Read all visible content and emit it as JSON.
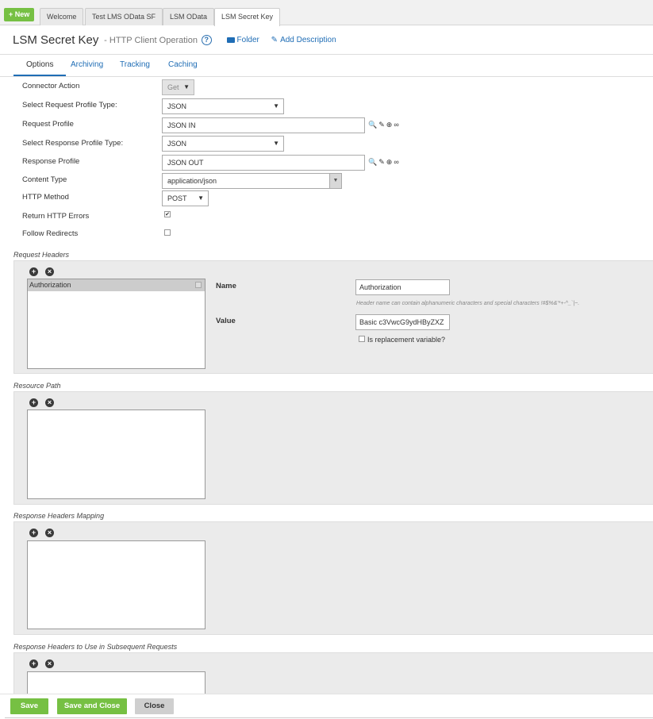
{
  "tabstrip": {
    "new_label": "+ New",
    "tabs": [
      {
        "label": "Welcome"
      },
      {
        "label": "Test LMS OData SF"
      },
      {
        "label": "LSM OData"
      },
      {
        "label": "LSM Secret Key"
      }
    ]
  },
  "header": {
    "title": "LSM Secret Key",
    "subtitle": "- HTTP Client Operation",
    "help": "?",
    "folder_link": "Folder",
    "description_link": "Add Description"
  },
  "subtabs": [
    "Options",
    "Archiving",
    "Tracking",
    "Caching"
  ],
  "form": {
    "connector_action": {
      "label": "Connector Action",
      "value": "Get"
    },
    "request_profile_type": {
      "label": "Select Request Profile Type:",
      "value": "JSON"
    },
    "request_profile": {
      "label": "Request Profile",
      "value": "JSON IN"
    },
    "response_profile_type": {
      "label": "Select Response Profile Type:",
      "value": "JSON"
    },
    "response_profile": {
      "label": "Response Profile",
      "value": "JSON OUT"
    },
    "content_type": {
      "label": "Content Type",
      "value": "application/json"
    },
    "http_method": {
      "label": "HTTP Method",
      "value": "POST"
    },
    "return_http_errors": {
      "label": "Return HTTP Errors",
      "checked": true
    },
    "follow_redirects": {
      "label": "Follow Redirects",
      "checked": false
    }
  },
  "request_headers": {
    "title": "Request Headers",
    "items": [
      "Authorization"
    ],
    "name_label": "Name",
    "name_value": "Authorization",
    "name_hint": "Header name can contain alphanumeric characters and special characters !#$%&'*+-^_`|~.",
    "value_label": "Value",
    "value_value": "Basic c3VwcG9ydHByZXZ",
    "replacement_label": "Is replacement variable?"
  },
  "resource_path": {
    "title": "Resource Path"
  },
  "response_headers_mapping": {
    "title": "Response Headers Mapping"
  },
  "response_headers_subsequent": {
    "title": "Response Headers to Use in Subsequent Requests"
  },
  "footer": {
    "save": "Save",
    "save_close": "Save and Close",
    "close": "Close"
  },
  "colors": {
    "accent_green": "#76c043",
    "link_blue": "#1f6db5",
    "panel_grey": "#ebebeb"
  },
  "icons": [
    "help-icon",
    "folder-icon",
    "pencil-icon",
    "search-icon",
    "edit-icon",
    "add-icon",
    "link-icon",
    "remove-icon",
    "checkbox-icon",
    "dropdown-caret-icon"
  ]
}
